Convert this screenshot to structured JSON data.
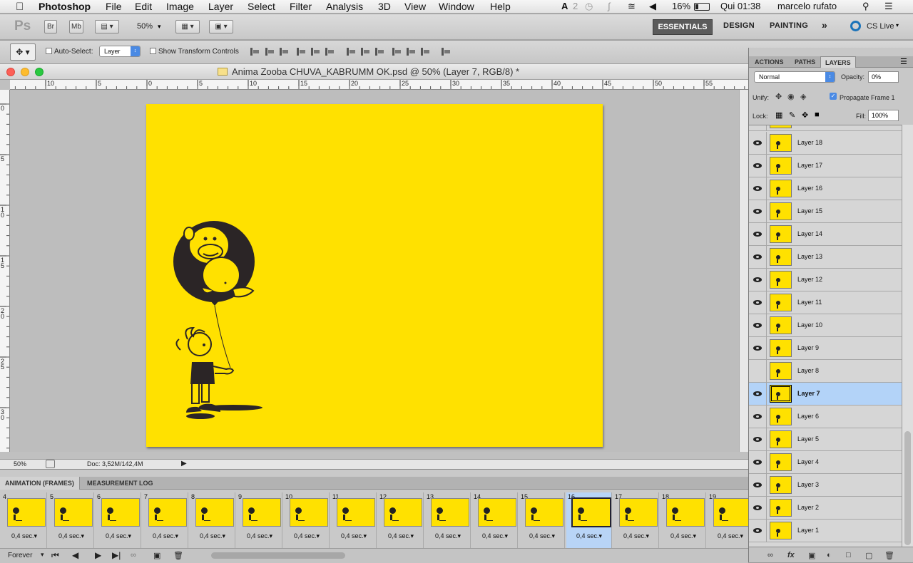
{
  "menubar": {
    "app": "Photoshop",
    "items": [
      "File",
      "Edit",
      "Image",
      "Layer",
      "Select",
      "Filter",
      "Analysis",
      "3D",
      "View",
      "Window",
      "Help"
    ],
    "status": {
      "battery": "16%",
      "clock": "Qui 01:38",
      "user": "marcelo rufato"
    }
  },
  "appbar": {
    "logo": "Ps",
    "bridge": "Br",
    "minibridge": "Mb",
    "zoom": "50%",
    "workspaces": [
      "ESSENTIALS",
      "DESIGN",
      "PAINTING"
    ],
    "cslive": "CS Live"
  },
  "options": {
    "autoselect_label": "Auto-Select:",
    "autoselect_value": "Layer",
    "transform_label": "Show Transform Controls"
  },
  "document": {
    "title": "Anima Zooba CHUVA_KABRUMM OK.psd @ 50% (Layer 7, RGB/8) *",
    "zoom": "50%",
    "doc_size": "Doc: 3,52M/142,4M",
    "hruler_labels": [
      "10",
      "5",
      "0",
      "5",
      "10",
      "15",
      "20",
      "25",
      "30",
      "35",
      "40",
      "45",
      "50",
      "55"
    ],
    "vruler_labels": [
      "0",
      "5",
      "1 0",
      "1 5",
      "2 0",
      "2 5",
      "3 0"
    ]
  },
  "animation": {
    "tabs": [
      "ANIMATION (FRAMES)",
      "MEASUREMENT LOG"
    ],
    "frames": [
      {
        "num": "4",
        "delay": "0,4 sec."
      },
      {
        "num": "5",
        "delay": "0,4 sec."
      },
      {
        "num": "6",
        "delay": "0,4 sec."
      },
      {
        "num": "7",
        "delay": "0,4 sec."
      },
      {
        "num": "8",
        "delay": "0,4 sec."
      },
      {
        "num": "9",
        "delay": "0,4 sec."
      },
      {
        "num": "10",
        "delay": "0,4 sec."
      },
      {
        "num": "11",
        "delay": "0,4 sec."
      },
      {
        "num": "12",
        "delay": "0,4 sec."
      },
      {
        "num": "13",
        "delay": "0,4 sec."
      },
      {
        "num": "14",
        "delay": "0,4 sec."
      },
      {
        "num": "15",
        "delay": "0,4 sec."
      },
      {
        "num": "16",
        "delay": "0,4 sec.",
        "selected": true
      },
      {
        "num": "17",
        "delay": "0,4 sec."
      },
      {
        "num": "18",
        "delay": "0,4 sec."
      },
      {
        "num": "19",
        "delay": "0,4 sec."
      }
    ],
    "loop": "Forever"
  },
  "panel": {
    "tabs": [
      "ACTIONS",
      "PATHS",
      "LAYERS"
    ],
    "blend_mode": "Normal",
    "opacity_label": "Opacity:",
    "opacity_value": "0%",
    "unify_label": "Unify:",
    "propagate_label": "Propagate Frame 1",
    "lock_label": "Lock:",
    "fill_label": "Fill:",
    "fill_value": "100%",
    "layers": [
      {
        "name": "Layer 18",
        "visible": true
      },
      {
        "name": "Layer 17",
        "visible": true
      },
      {
        "name": "Layer 16",
        "visible": true
      },
      {
        "name": "Layer 15",
        "visible": true
      },
      {
        "name": "Layer 14",
        "visible": true
      },
      {
        "name": "Layer 13",
        "visible": true
      },
      {
        "name": "Layer 12",
        "visible": true
      },
      {
        "name": "Layer 11",
        "visible": true
      },
      {
        "name": "Layer 10",
        "visible": true
      },
      {
        "name": "Layer 9",
        "visible": true
      },
      {
        "name": "Layer 8",
        "visible": false
      },
      {
        "name": "Layer 7",
        "visible": true,
        "selected": true
      },
      {
        "name": "Layer 6",
        "visible": true
      },
      {
        "name": "Layer 5",
        "visible": true
      },
      {
        "name": "Layer 4",
        "visible": true
      },
      {
        "name": "Layer 3",
        "visible": true
      },
      {
        "name": "Layer 2",
        "visible": true
      },
      {
        "name": "Layer 1",
        "visible": true
      }
    ]
  },
  "colors": {
    "canvas": "#ffe100",
    "selection": "#b3d3f8"
  }
}
